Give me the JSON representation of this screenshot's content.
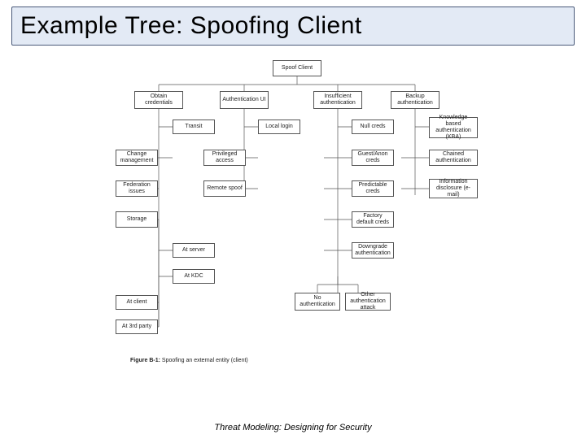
{
  "title": "Example Tree: Spoofing Client",
  "footer": "Threat Modeling: Designing for Security",
  "caption_label": "Figure B-1:",
  "caption_text": "Spoofing an external entity (client)",
  "nodes": {
    "root": "Spoof Client",
    "l1_obtain": "Obtain credentials",
    "l1_authui": "Authentication UI",
    "l1_insuff": "Insufficient authentication",
    "l1_backup": "Backup authentication",
    "oc_transit": "Transit",
    "oc_change": "Change management",
    "oc_federation": "Federation issues",
    "oc_storage": "Storage",
    "oc_at_server": "At server",
    "oc_at_kdc": "At KDC",
    "oc_at_client": "At client",
    "oc_at_3rd": "At 3rd party",
    "au_local": "Local login",
    "au_priv": "Privileged access",
    "au_remote": "Remote spoof",
    "ia_null": "Null creds",
    "ia_guest": "Guest/Anon creds",
    "ia_predict": "Predictable creds",
    "ia_factory": "Factory default creds",
    "ia_downgrade": "Downgrade authentication",
    "ia_noauth": "No authentication",
    "ia_other": "Other authentication attack",
    "ba_kba": "Knowledge based authentication (KBA)",
    "ba_chained": "Chained authentication",
    "ba_info": "Information disclosure (e-mail)"
  }
}
